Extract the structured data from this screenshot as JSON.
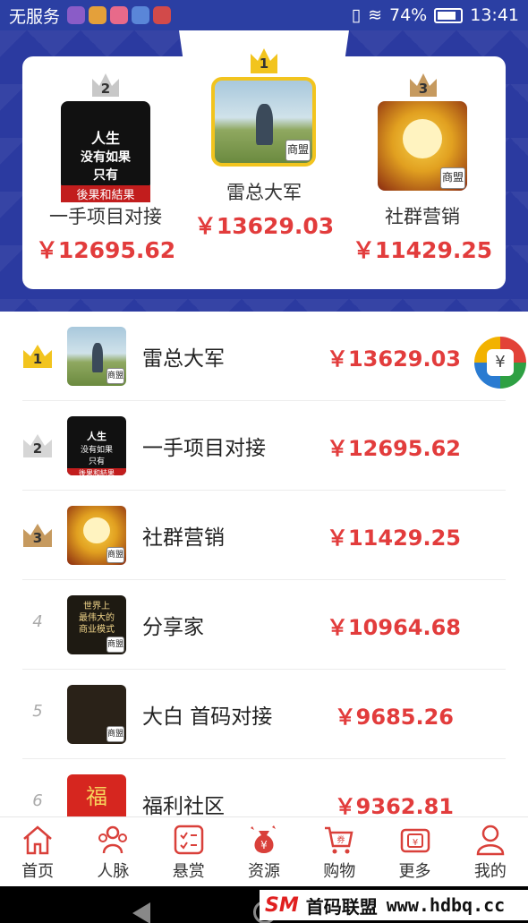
{
  "status_bar": {
    "carrier": "无服务",
    "battery": "74%",
    "time": "13:41"
  },
  "podium": [
    {
      "rank": "2",
      "name": "一手项目对接",
      "amount": "￥12695.62",
      "crown_color": "#c8c8c8"
    },
    {
      "rank": "1",
      "name": "雷总大军",
      "amount": "￥13629.03",
      "crown_color": "#f2c41e"
    },
    {
      "rank": "3",
      "name": "社群营销",
      "amount": "￥11429.25",
      "crown_color": "#c69a5f"
    }
  ],
  "ranking": [
    {
      "rank": "1",
      "name": "雷总大军",
      "amount": "￥13629.03",
      "avatar": "photo",
      "badge": "商盟"
    },
    {
      "rank": "2",
      "name": "一手项目对接",
      "amount": "￥12695.62",
      "avatar": "black",
      "badge": ""
    },
    {
      "rank": "3",
      "name": "社群营销",
      "amount": "￥11429.25",
      "avatar": "cat",
      "badge": "商盟"
    },
    {
      "rank": "4",
      "name": "分享家",
      "amount": "￥10964.68",
      "avatar": "dark",
      "badge": "商盟"
    },
    {
      "rank": "5",
      "name": "大白 首码对接",
      "amount": "￥9685.26",
      "avatar": "dark2",
      "badge": "商盟"
    },
    {
      "rank": "6",
      "name": "福利社区",
      "amount": "￥9362.81",
      "avatar": "red",
      "badge": ""
    }
  ],
  "avatar_text": {
    "black_l1": "人生",
    "black_l2": "没有如果",
    "black_l3": "只有",
    "black_l4": "後果和結果",
    "dark_l1": "世界上",
    "dark_l2": "最伟大的",
    "dark_l3": "商业模式",
    "red_char": "福"
  },
  "tabs": [
    {
      "label": "首页",
      "icon": "home-icon"
    },
    {
      "label": "人脉",
      "icon": "contacts-icon"
    },
    {
      "label": "悬赏",
      "icon": "task-list-icon"
    },
    {
      "label": "资源",
      "icon": "money-bag-icon"
    },
    {
      "label": "购物",
      "icon": "cart-icon"
    },
    {
      "label": "更多",
      "icon": "wallet-icon"
    },
    {
      "label": "我的",
      "icon": "user-icon"
    }
  ],
  "watermark": {
    "logo": "SM",
    "text": "首码联盟",
    "url": "www.hdbq.cc"
  },
  "colors": {
    "accent_red": "#e23c3c",
    "header_blue": "#2b3aa0",
    "gold": "#f2c41e",
    "silver": "#c8c8c8",
    "bronze": "#c69a5f"
  }
}
